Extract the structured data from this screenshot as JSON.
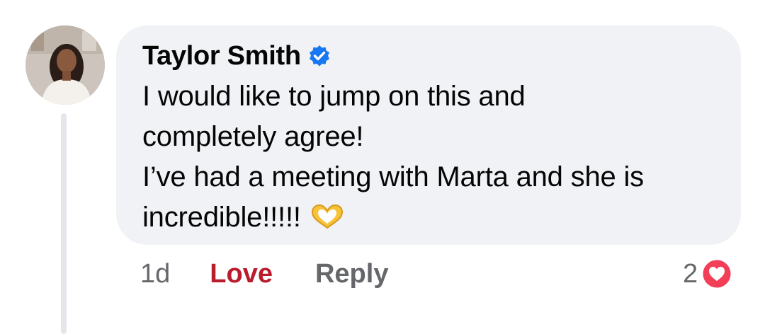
{
  "comment": {
    "author": "Taylor Smith",
    "verified": true,
    "text_lines": [
      "I would like to jump on this and",
      "completely agree!",
      "I’ve had a meeting with Marta and she is",
      "incredible!!!!!"
    ],
    "emoji": "heart-hands-icon",
    "timestamp": "1d",
    "actions": {
      "reaction_label": "Love",
      "reply_label": "Reply"
    },
    "reactions": {
      "count": "2",
      "type": "love-reaction-icon"
    }
  },
  "colors": {
    "bubble": "#f0f2f5",
    "text": "#050505",
    "secondary": "#65676b",
    "love": "#b91c2c",
    "love_badge": "#f33e58",
    "verified": "#1877f2"
  }
}
